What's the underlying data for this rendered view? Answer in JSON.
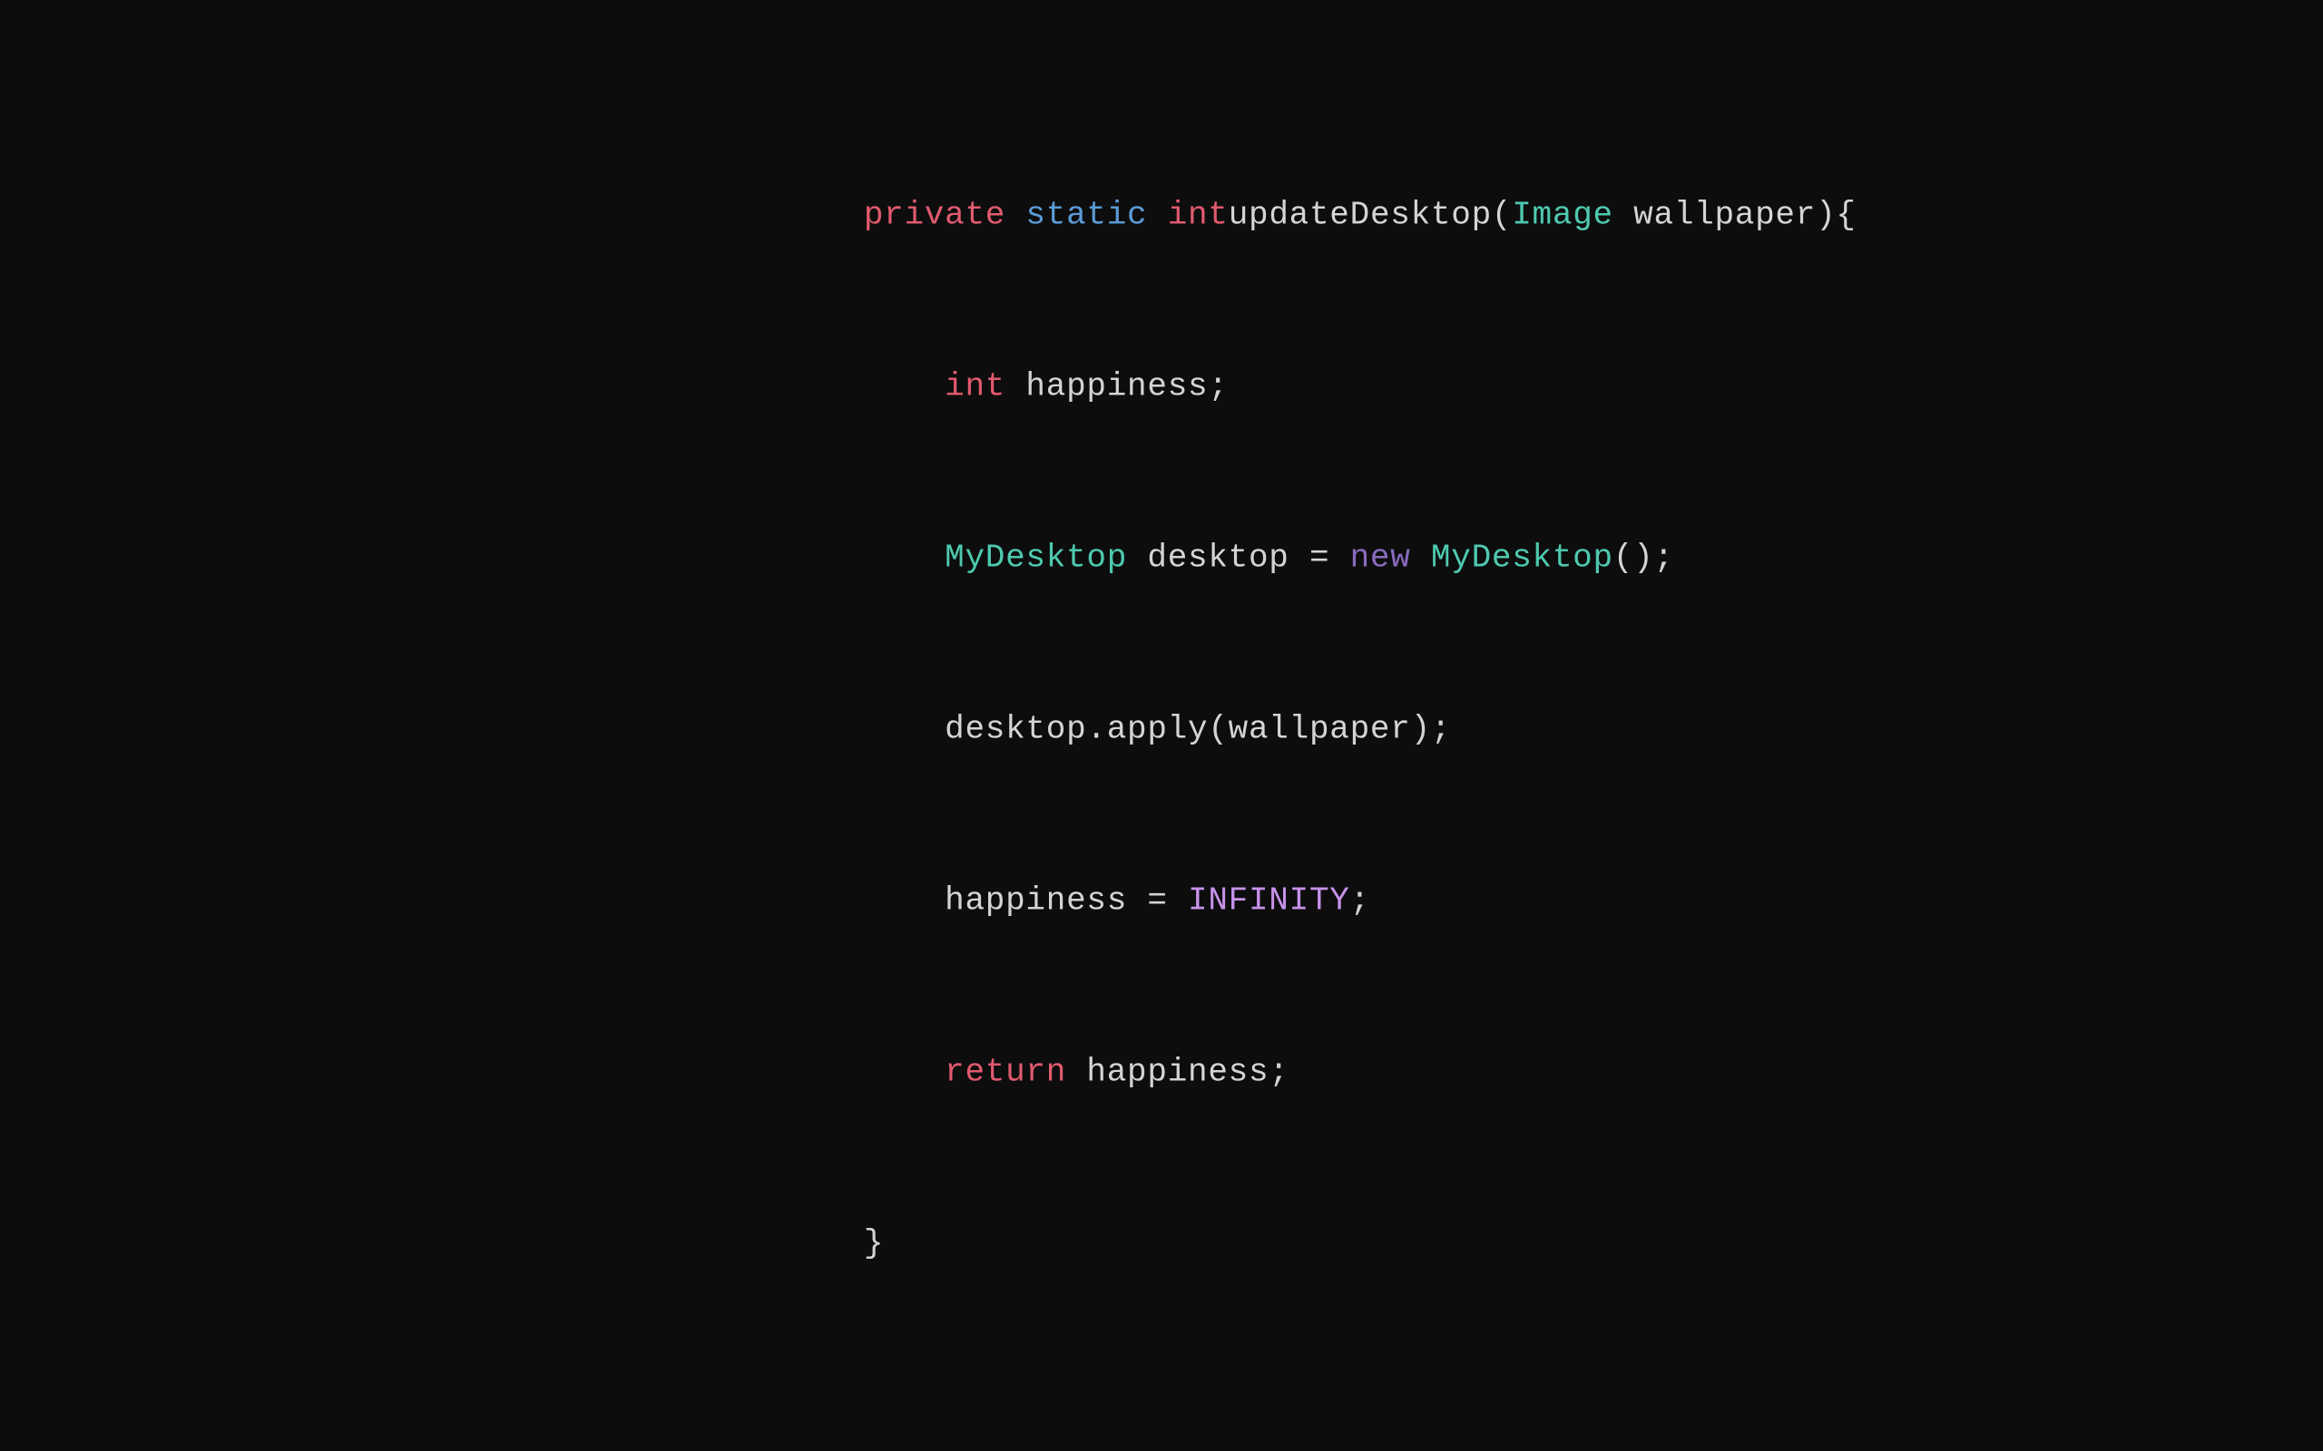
{
  "code": {
    "line1": {
      "private": "private",
      "space1": " ",
      "static": "static",
      "space2": " ",
      "int": "int",
      "space3": " ",
      "rest": "updateDesktop(",
      "Image": "Image",
      "rest2": " wallpaper){"
    },
    "line2": {
      "indent": "    ",
      "int": "int",
      "rest": " happiness;"
    },
    "line3": {
      "indent": "    ",
      "MyDesktop": "MyDesktop",
      "rest": " desktop = ",
      "new": "new",
      "space": " ",
      "MyDesktop2": "MyDesktop",
      "rest2": "();"
    },
    "line4": {
      "indent": "    ",
      "rest": "desktop.apply(wallpaper);"
    },
    "line5": {
      "indent": "    ",
      "rest": "happiness = ",
      "INFINITY": "INFINITY",
      "rest2": ";"
    },
    "line6": {
      "indent": "    ",
      "return": "return",
      "rest": " happiness;"
    },
    "line7": {
      "brace": "}"
    }
  }
}
